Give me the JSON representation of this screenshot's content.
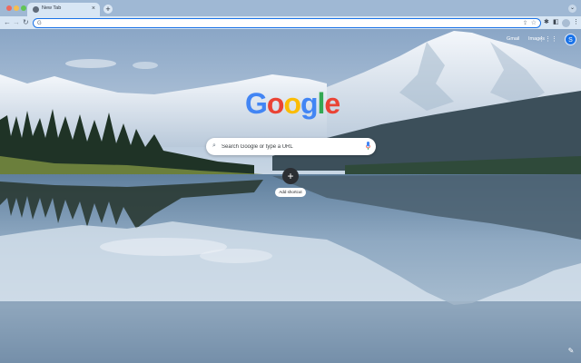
{
  "browser": {
    "tab": {
      "title": "New Tab",
      "close_glyph": "×",
      "favicon": "chrome-logo-icon"
    },
    "new_tab_glyph": "+",
    "tab_menu_glyph": "⌄",
    "toolbar": {
      "back_glyph": "←",
      "forward_glyph": "→",
      "reload_glyph": "↻",
      "omnibox_icon_glyph": "G",
      "share_glyph": "⇪",
      "star_glyph": "☆",
      "extensions_glyph": "✱",
      "sidepanel_glyph": "◧",
      "more_glyph": "⋮"
    }
  },
  "ntp": {
    "top_links": [
      "Gmail",
      "Images"
    ],
    "apps_glyph": "⋮⋮⋮",
    "account_initial": "S",
    "logo": {
      "letters": [
        "G",
        "o",
        "o",
        "g",
        "l",
        "e"
      ],
      "colors": [
        "#4285f4",
        "#ea4335",
        "#fbbc05",
        "#4285f4",
        "#34a853",
        "#ea4335"
      ]
    },
    "search": {
      "placeholder": "Search Google or type a URL",
      "icon_glyph": "⌕"
    },
    "shortcut": {
      "glyph": "+",
      "label": "Add shortcut"
    },
    "customize_glyph": "✎"
  },
  "colors": {
    "accent": "#1a73e8",
    "tab_bar": "#9fb8d4",
    "toolbar": "#d8e6f4"
  }
}
